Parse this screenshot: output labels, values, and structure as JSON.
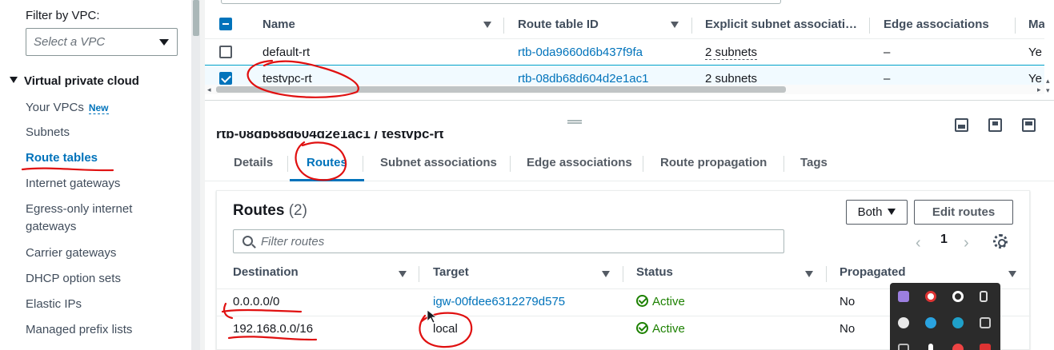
{
  "sidebar": {
    "filter_label": "Filter by VPC:",
    "select_placeholder": "Select a VPC",
    "section_title": "Virtual private cloud",
    "items": [
      {
        "label": "Your VPCs",
        "badge": "New"
      },
      {
        "label": "Subnets"
      },
      {
        "label": "Route tables"
      },
      {
        "label": "Internet gateways"
      },
      {
        "label": "Egress-only internet gateways"
      },
      {
        "label": "Carrier gateways"
      },
      {
        "label": "DHCP option sets"
      },
      {
        "label": "Elastic IPs"
      },
      {
        "label": "Managed prefix lists"
      }
    ]
  },
  "route_table_list": {
    "columns": [
      "Name",
      "Route table ID",
      "Explicit subnet associati…",
      "Edge associations",
      "Ma"
    ],
    "rows": [
      {
        "name": "default-rt",
        "id": "rtb-0da9660d6b437f9fa",
        "subnets": "2 subnets",
        "edge": "–",
        "main": "Ye",
        "selected": false
      },
      {
        "name": "testvpc-rt",
        "id": "rtb-08db68d604d2e1ac1",
        "subnets": "2 subnets",
        "edge": "–",
        "main": "Ye",
        "selected": true
      }
    ]
  },
  "detail": {
    "title": "rtb-08db68d604d2e1ac1 / testvpc-rt",
    "tabs": [
      "Details",
      "Routes",
      "Subnet associations",
      "Edge associations",
      "Route propagation",
      "Tags"
    ],
    "active_tab": "Routes"
  },
  "routes": {
    "title": "Routes",
    "count": "(2)",
    "filter_dropdown": "Both",
    "edit_button": "Edit routes",
    "filter_placeholder": "Filter routes",
    "page": "1",
    "columns": [
      "Destination",
      "Target",
      "Status",
      "Propagated"
    ],
    "rows": [
      {
        "destination": "0.0.0.0/0",
        "target": "igw-00fdee6312279d575",
        "status": "Active",
        "propagated": "No"
      },
      {
        "destination": "192.168.0.0/16",
        "target": "local",
        "status": "Active",
        "propagated": "No"
      }
    ]
  },
  "colors": {
    "link": "#0073bb",
    "active_status": "#1d8102",
    "annotation": "#e01010"
  }
}
